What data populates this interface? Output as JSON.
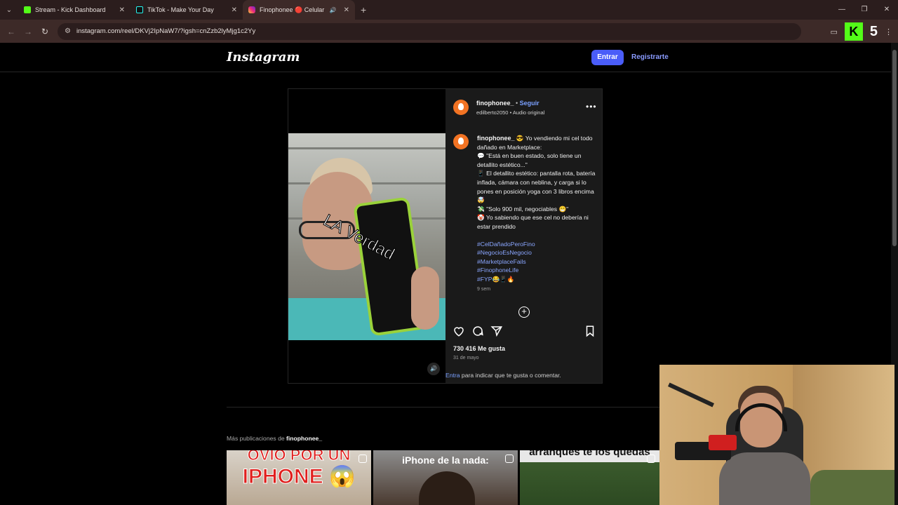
{
  "browser": {
    "tabs": [
      {
        "title": "Stream - Kick Dashboard",
        "active": false,
        "favicon_color": "#53fc18"
      },
      {
        "title": "TikTok - Make Your Day",
        "active": false,
        "favicon_color": "#111111"
      },
      {
        "title": "Finophonee 🔴 Celular",
        "active": true,
        "favicon_color": "#e1306c"
      }
    ],
    "url": "instagram.com/reel/DKVj2IpNaW7/?igsh=cnZzb2lyMjg1c2Yy",
    "ext_counter": "5"
  },
  "ig_header": {
    "logo": "Instagram",
    "login_label": "Entrar",
    "register_label": "Registrarte"
  },
  "post": {
    "video_overlay_text": "LA Verdad",
    "username": "finophonee_",
    "follow_label": "Seguir",
    "audio_user": "edilberto2050",
    "audio_label": "Audio original",
    "caption_lines": [
      "😎 Yo vendiendo mi cel todo dañado en Marketplace:",
      "💬 \"Está en buen estado, solo tiene un detallito estético...\"",
      "📱 El detallito estético: pantalla rota, batería inflada, cámara con neblina, y carga si lo pones en posición yoga con 3 libros encima 🤯",
      "💸 \"Solo 900 mil, negociables 😁\"",
      "🤡 Yo sabiendo que ese cel no debería ni estar prendido"
    ],
    "hashtags": [
      "#CelDañadoPeroFino",
      "#NegocioEsNegocio",
      "#MarketplaceFails",
      "#FinophoneLife",
      "#FYP😂📱🔥"
    ],
    "age": "9 sem",
    "likes": "730 416 Me gusta",
    "date": "31 de mayo",
    "login_link": "Entra",
    "login_hint": " para indicar que te gusta o comentar."
  },
  "more_posts": {
    "label": "Más publicaciones de ",
    "username": "finophonee_",
    "thumbs": [
      {
        "caption": "IPHONE 😱",
        "caption_top": "OVIO POR UN"
      },
      {
        "caption": "iPhone de la nada:"
      },
      {
        "caption": "arranques te los quedas"
      }
    ]
  },
  "colors": {
    "accent_blue": "#4a5df9",
    "link_blue": "#7aa0ff",
    "kick_green": "#53fc18"
  }
}
